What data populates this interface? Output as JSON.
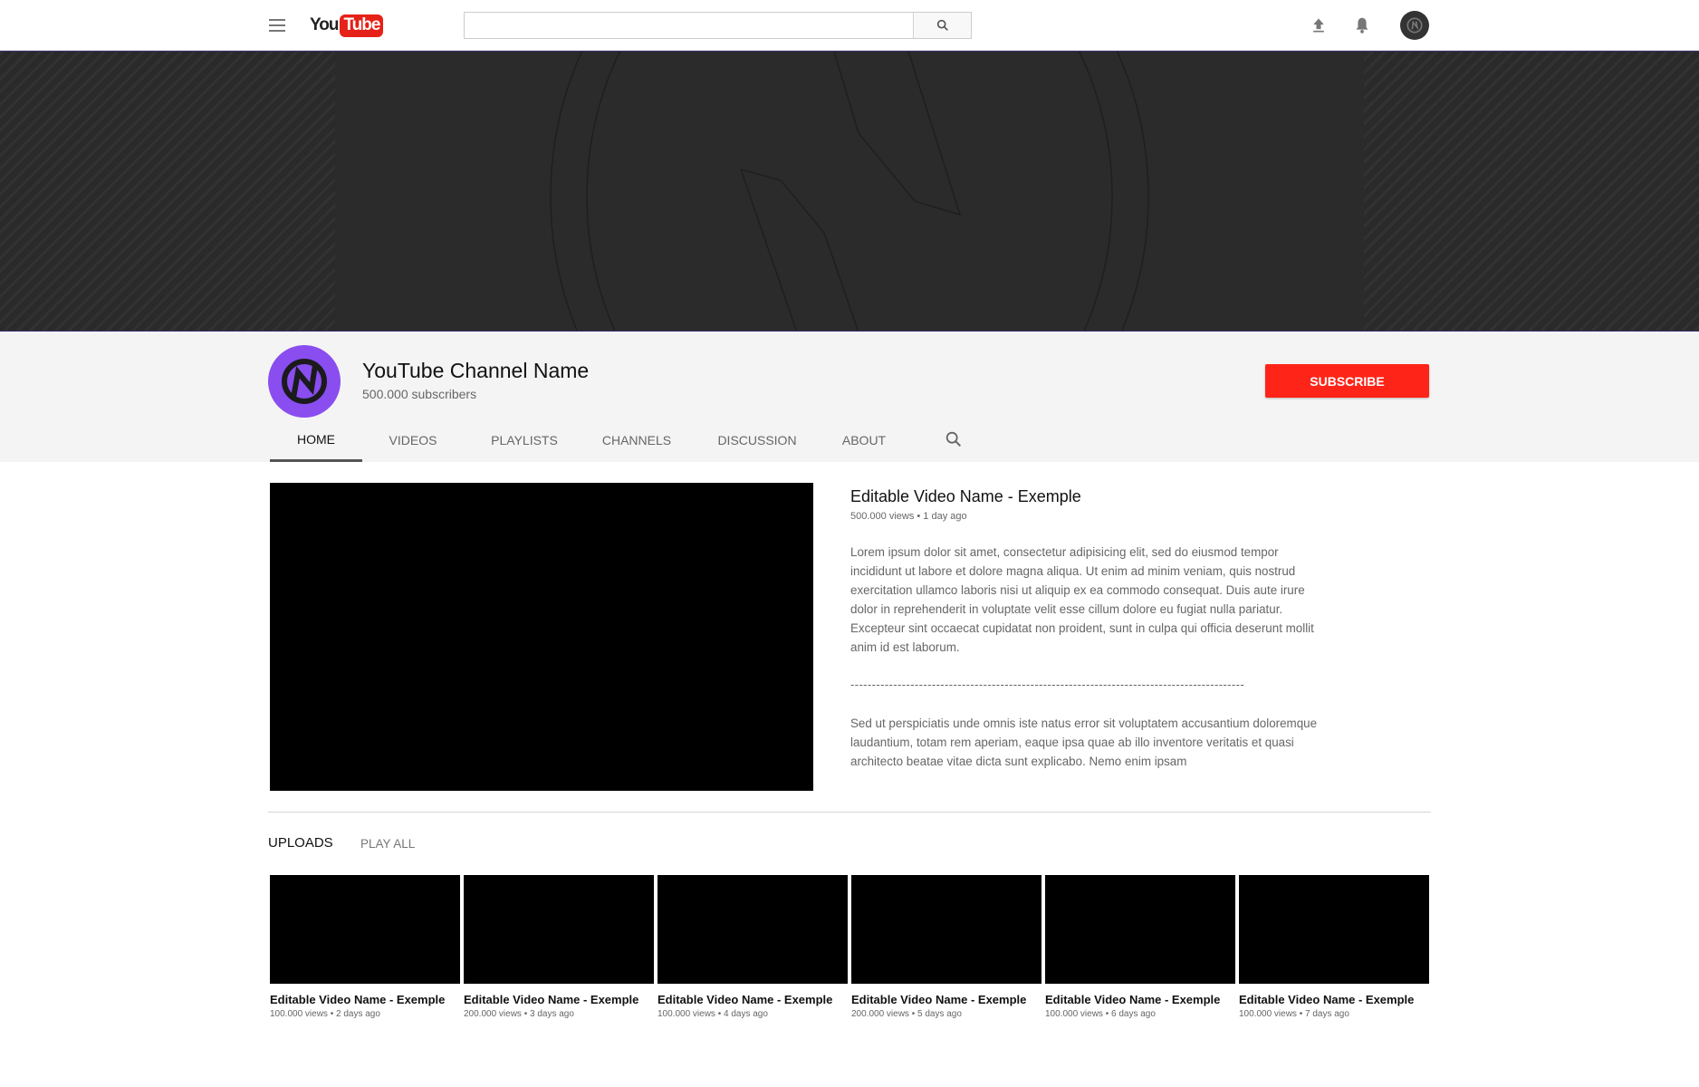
{
  "header": {
    "logo_you": "You",
    "logo_tube": "Tube",
    "search_placeholder": ""
  },
  "channel": {
    "name": "YouTube Channel Name",
    "subscribers": "500.000 subscribers",
    "subscribe_label": "SUBSCRIBE",
    "avatar_color": "#8a4df0"
  },
  "tabs": [
    {
      "label": "HOME",
      "active": true
    },
    {
      "label": "VIDEOS"
    },
    {
      "label": "PLAYLISTS"
    },
    {
      "label": "CHANNELS"
    },
    {
      "label": "DISCUSSION"
    },
    {
      "label": "ABOUT"
    }
  ],
  "featured": {
    "title": "Editable Video Name - Exemple",
    "meta": "500.000 views • 1 day ago",
    "description": "Lorem ipsum dolor sit amet, consectetur adipisicing elit, sed do eiusmod tempor incididunt ut labore et dolore magna aliqua. Ut enim ad minim veniam, quis nostrud exercitation ullamco laboris nisi ut aliquip ex ea commodo consequat. Duis aute irure dolor in reprehenderit in voluptate velit esse cillum dolore eu fugiat nulla pariatur. Excepteur sint occaecat cupidatat non proident, sunt in culpa qui officia deserunt mollit anim id est laborum.",
    "divider": "--------------------------------------------------------------------------------------------",
    "description2": "Sed ut perspiciatis unde omnis iste natus error sit voluptatem accusantium doloremque laudantium, totam rem aperiam, eaque ipsa quae ab illo inventore veritatis et quasi architecto beatae vitae dicta sunt explicabo. Nemo enim ipsam"
  },
  "uploads": {
    "title": "UPLOADS",
    "play_all": "PLAY ALL",
    "videos": [
      {
        "title": "Editable Video Name - Exemple",
        "meta": "100.000 views • 2 days ago"
      },
      {
        "title": "Editable Video Name - Exemple",
        "meta": "200.000 views • 3 days ago"
      },
      {
        "title": "Editable Video Name - Exemple",
        "meta": "100.000 views • 4 days ago"
      },
      {
        "title": "Editable Video Name - Exemple",
        "meta": "200.000 views • 5 days ago"
      },
      {
        "title": "Editable Video Name - Exemple",
        "meta": "100.000 views • 6 days ago"
      },
      {
        "title": "Editable Video Name - Exemple",
        "meta": "100.000 views • 7 days ago"
      }
    ]
  },
  "colors": {
    "subscribe": "#fe2417",
    "logo_red": "#e62117",
    "banner": "#2a2a2b"
  },
  "icons": [
    "menu-icon",
    "search-icon",
    "upload-icon",
    "bell-icon",
    "user-avatar",
    "channel-logo"
  ]
}
